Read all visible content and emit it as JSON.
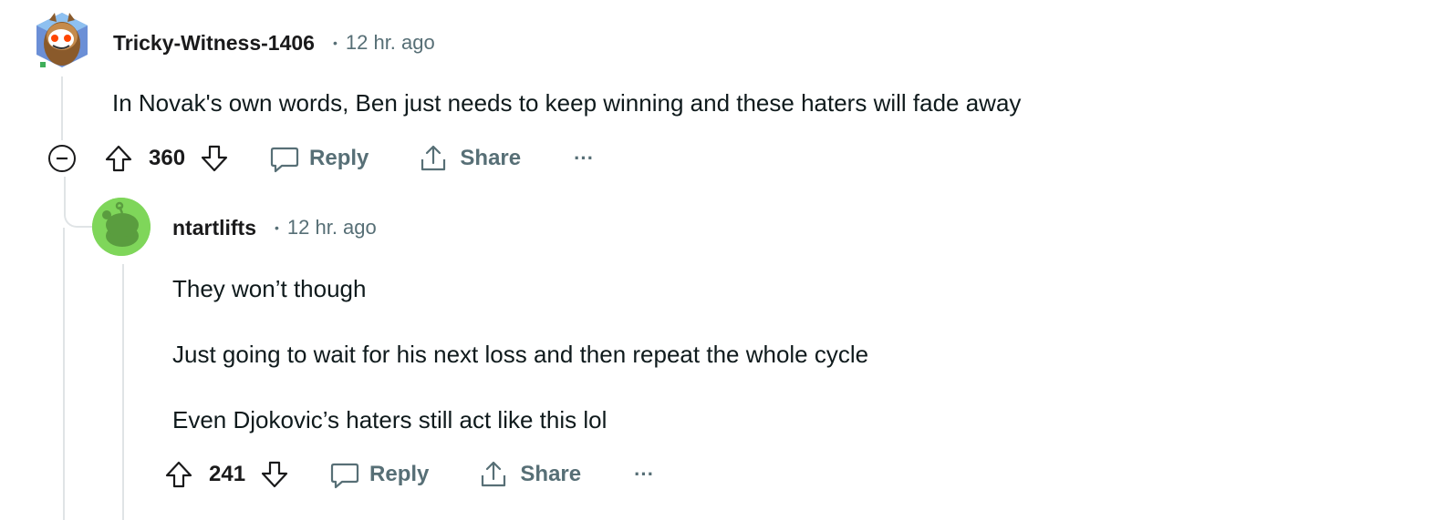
{
  "comments": [
    {
      "username": "Tricky-Witness-1406",
      "separator": "•",
      "timestamp": "12 hr. ago",
      "body": [
        "In Novak's own words, Ben just needs to keep winning and these haters will fade away"
      ],
      "score": "360",
      "reply_label": "Reply",
      "share_label": "Share",
      "more_label": "···",
      "avatar_icon": "snoo-owl-avatar"
    },
    {
      "username": "ntartlifts",
      "separator": "•",
      "timestamp": "12 hr. ago",
      "body": [
        "They won’t though",
        "Just going to wait for his next loss and then repeat the whole cycle",
        "Even Djokovic’s haters still act like this lol"
      ],
      "score": "241",
      "reply_label": "Reply",
      "share_label": "Share",
      "more_label": "···",
      "avatar_icon": "default-snoo-avatar"
    }
  ],
  "colors": {
    "text": "#0f1a1c",
    "muted": "#576f76",
    "thread_line": "#e0e4e6",
    "avatar_green": "#7fd65a"
  }
}
